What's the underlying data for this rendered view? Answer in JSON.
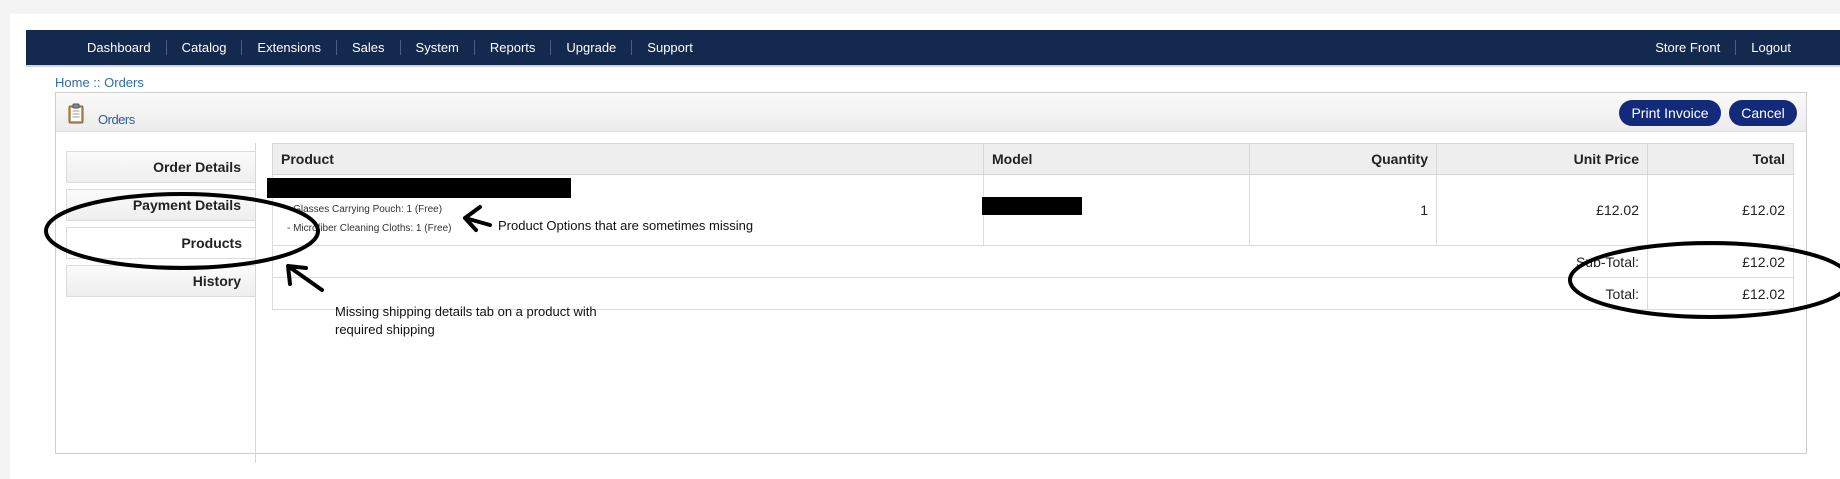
{
  "nav": {
    "left": [
      "Dashboard",
      "Catalog",
      "Extensions",
      "Sales",
      "System",
      "Reports",
      "Upgrade",
      "Support"
    ],
    "right": [
      "Store Front",
      "Logout"
    ]
  },
  "breadcrumb": {
    "home": "Home",
    "sep": " :: ",
    "current": "Orders"
  },
  "box": {
    "title": "Orders",
    "print_label": "Print Invoice",
    "cancel_label": "Cancel"
  },
  "tabs": [
    {
      "label": "Order Details"
    },
    {
      "label": "Payment Details"
    },
    {
      "label": "Products"
    },
    {
      "label": "History"
    }
  ],
  "table": {
    "headers": [
      "Product",
      "Model",
      "Quantity",
      "Unit Price",
      "Total"
    ],
    "row": {
      "options": [
        "- Glasses Carrying Pouch: 1 (Free)",
        "- Microfiber Cleaning Cloths: 1 (Free)"
      ],
      "quantity": "1",
      "unit_price": "£12.02",
      "total": "£12.02"
    },
    "subtotal_label": "Sub-Total:",
    "subtotal": "£12.02",
    "total_label": "Total:",
    "total": "£12.02"
  },
  "annotations": {
    "options_note": "Product Options that are sometimes missing",
    "shipping_note_line1": "Missing shipping details tab on a product with",
    "shipping_note_line2": "required shipping"
  },
  "colors": {
    "nav_bg": "#13294e",
    "button_bg": "#13297a",
    "link": "#2e6da4"
  }
}
